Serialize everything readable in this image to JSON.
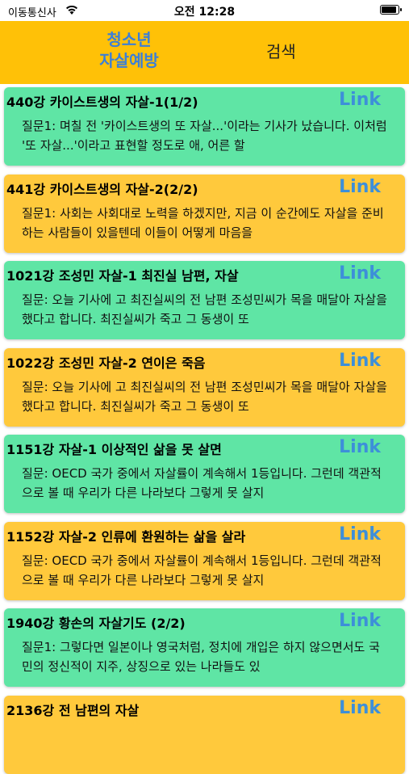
{
  "status": {
    "carrier": "이동통신사",
    "time": "오전 12:28",
    "battery_level": 0.95
  },
  "header": {
    "brand_line1": "청소년",
    "brand_line2": "자살예방",
    "search_label": "검색",
    "background": "#ffc107",
    "brand_color": "#3d7fd6"
  },
  "colors": {
    "green_card": "#5fe5a5",
    "yellow_card": "#ffc93c",
    "link": "#3d8fd9"
  },
  "items": [
    {
      "title": "440강 카이스트생의 자살-1(1/2)",
      "link": "Link",
      "body": "질문1: 며칠 전 '카이스트생의 또 자살...'이라는 기사가 났습니다. 이처럼 '또 자살...'이라고 표현할 정도로 애, 어른 할"
    },
    {
      "title": "441강 카이스트생의 자살-2(2/2)",
      "link": "Link",
      "body": "질문1: 사회는 사회대로 노력을 하겠지만, 지금 이 순간에도 자살을 준비하는 사람들이 있을텐데 이들이 어떻게 마음을"
    },
    {
      "title": "1021강 조성민 자살-1 최진실 남편, 자살",
      "link": "Link",
      "body": "질문: 오늘 기사에 고 최진실씨의 전 남편 조성민씨가 목을 매달아 자살을 했다고 합니다. 최진실씨가 죽고 그 동생이 또"
    },
    {
      "title": "1022강 조성민 자살-2 연이은 죽음",
      "link": "Link",
      "body": "질문: 오늘 기사에 고 최진실씨의 전 남편 조성민씨가 목을 매달아 자살을 했다고 합니다. 최진실씨가 죽고 그 동생이 또"
    },
    {
      "title": "1151강 자살-1 이상적인 삶을 못 살면",
      "link": "Link",
      "body": "질문: OECD 국가 중에서 자살률이 계속해서 1등입니다. 그런데 객관적으로 볼 때 우리가 다른 나라보다 그렇게 못 살지"
    },
    {
      "title": "1152강 자살-2 인류에 환원하는 삶을 살라",
      "link": "Link",
      "body": "질문: OECD 국가 중에서 자살률이 계속해서 1등입니다. 그런데 객관적으로 볼 때 우리가 다른 나라보다 그렇게 못 살지"
    },
    {
      "title": "1940강 황손의 자살기도 (2/2)",
      "link": "Link",
      "body": "질문1: 그렇다면 일본이나 영국처럼, 정치에 개입은 하지 않으면서도 국민의 정신적이 지주, 상징으로 있는 나라들도 있"
    },
    {
      "title": "2136강 전 남편의 자살",
      "link": "Link",
      "body": ""
    }
  ]
}
